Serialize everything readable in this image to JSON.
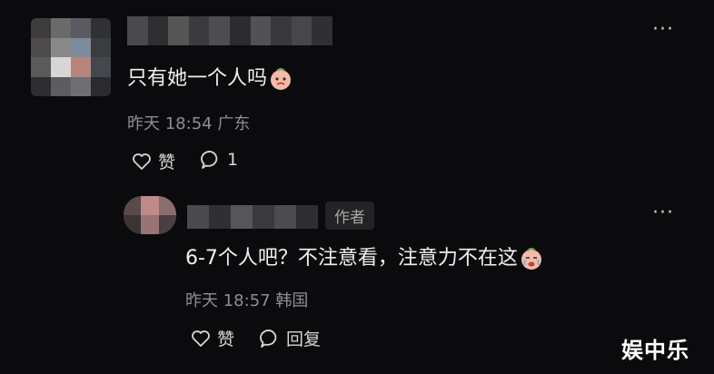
{
  "comment": {
    "text": "只有她一个人吗",
    "time": "昨天 18:54 广东",
    "like_label": "赞",
    "reply_count": "1"
  },
  "reply": {
    "author_badge": "作者",
    "text": "6-7个人吧？不注意看，注意力不在这",
    "time": "昨天 18:57 韩国",
    "like_label": "赞",
    "reply_label": "回复"
  },
  "more_glyph": "···",
  "watermark": "娱中乐",
  "colors": {
    "background": "#0b0b0d",
    "text": "#f0f0f0",
    "meta": "#8e8e93"
  },
  "icons": [
    "heart-icon",
    "comment-bubble-icon",
    "more-dots-icon",
    "emoji-icon"
  ]
}
